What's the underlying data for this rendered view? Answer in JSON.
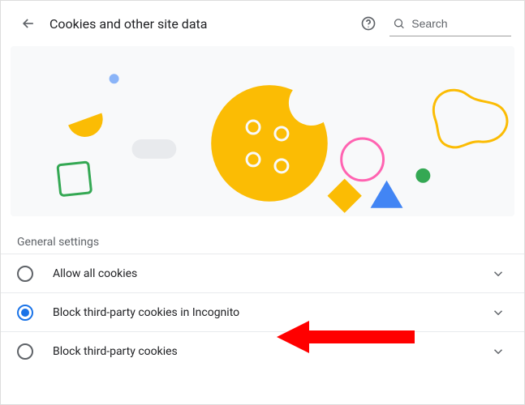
{
  "header": {
    "title": "Cookies and other site data",
    "search_placeholder": "Search"
  },
  "section_label": "General settings",
  "options": [
    {
      "label": "Allow all cookies",
      "selected": false
    },
    {
      "label": "Block third-party cookies in Incognito",
      "selected": true
    },
    {
      "label": "Block third-party cookies",
      "selected": false
    }
  ],
  "icons": {
    "back": "back-arrow-icon",
    "help": "help-icon",
    "search": "search-icon",
    "expand": "chevron-down-icon"
  },
  "annotation": {
    "type": "red-arrow",
    "points_to_option_index": 1
  }
}
